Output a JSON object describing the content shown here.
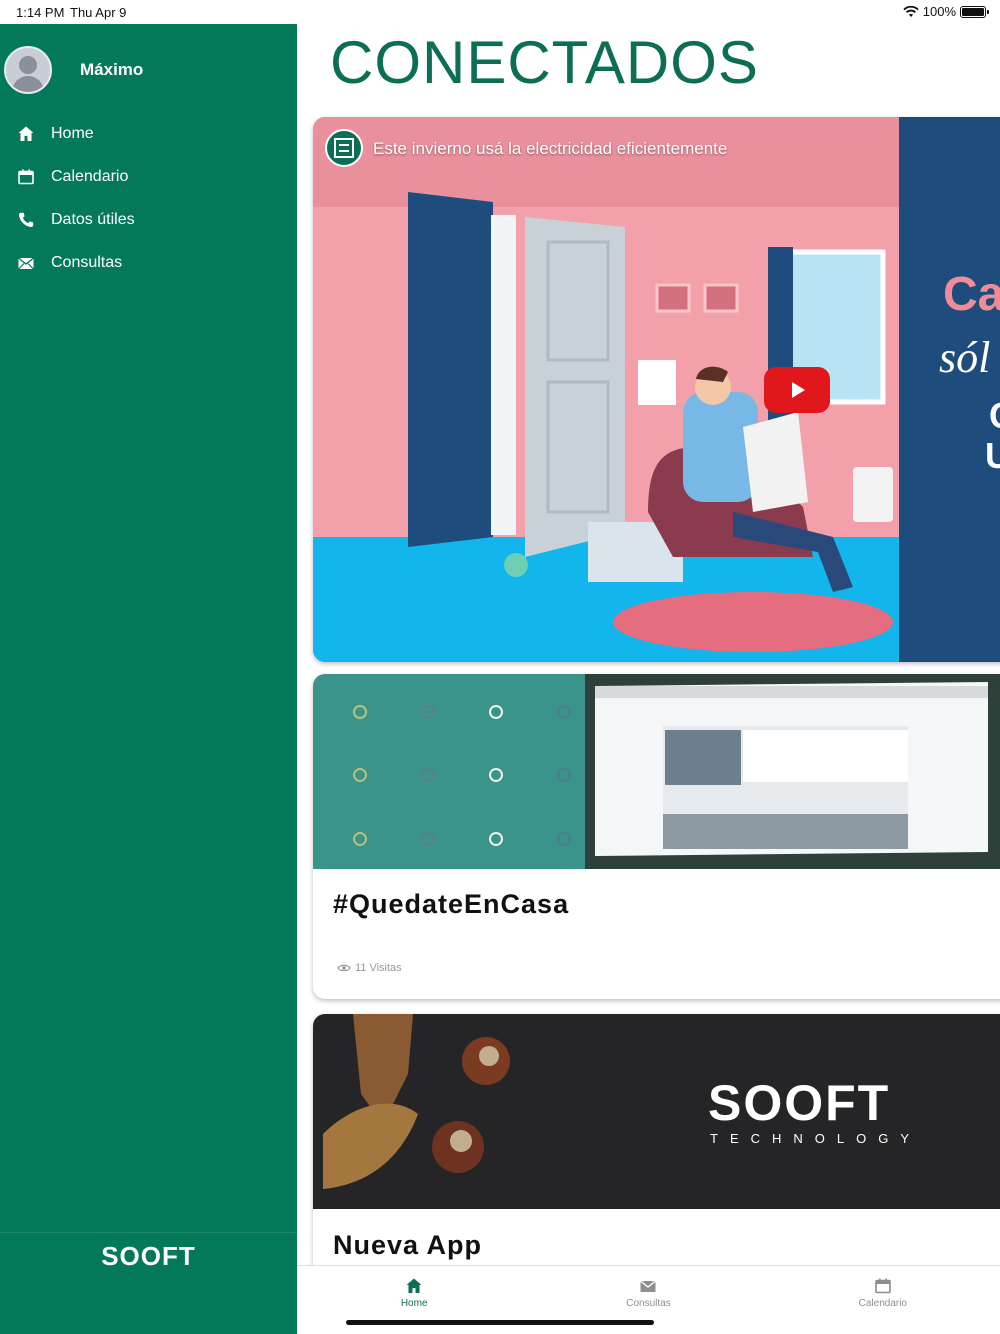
{
  "status": {
    "time": "1:14 PM",
    "date": "Thu Apr 9",
    "battery": "100%"
  },
  "sidebar": {
    "username": "Máximo",
    "items": [
      {
        "label": "Home",
        "icon": "home-icon"
      },
      {
        "label": "Calendario",
        "icon": "calendar-icon"
      },
      {
        "label": "Datos útiles",
        "icon": "phone-icon"
      },
      {
        "label": "Consultas",
        "icon": "mail-icon"
      }
    ],
    "logo": "SOOFT"
  },
  "main": {
    "title": "CONECTADOS",
    "video": {
      "title": "Este invierno usá la electricidad eficientemente",
      "side_text_1": "Ca",
      "side_text_2": "sól",
      "side_text_3": "C",
      "side_text_4": "U"
    },
    "news": [
      {
        "title": "#QuedateEnCasa",
        "views": "11 Visitas"
      },
      {
        "title": "Nueva App",
        "brand": "SOOFT",
        "brand_sub": "TECHNOLOGY"
      }
    ]
  },
  "tabbar": {
    "tabs": [
      {
        "label": "Home",
        "active": true
      },
      {
        "label": "Consultas",
        "active": false
      },
      {
        "label": "Calendario",
        "active": false
      }
    ]
  },
  "colors": {
    "brand": "#03795a",
    "title": "#0b6e55",
    "play": "#e0181b"
  }
}
